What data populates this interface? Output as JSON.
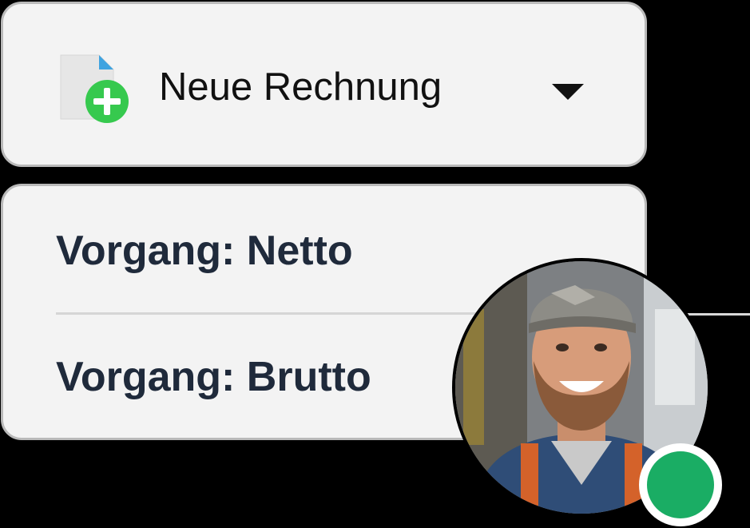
{
  "dropdown": {
    "label": "Neue Rechnung",
    "icon": "new-document-plus-icon",
    "caret_icon": "caret-down-icon"
  },
  "menu": {
    "items": [
      {
        "label": "Vorgang: Netto"
      },
      {
        "label": "Vorgang: Brutto"
      }
    ]
  },
  "user": {
    "avatar": "smiling-worker-with-cap-photo",
    "status": "online",
    "status_color": "#1aad64"
  }
}
